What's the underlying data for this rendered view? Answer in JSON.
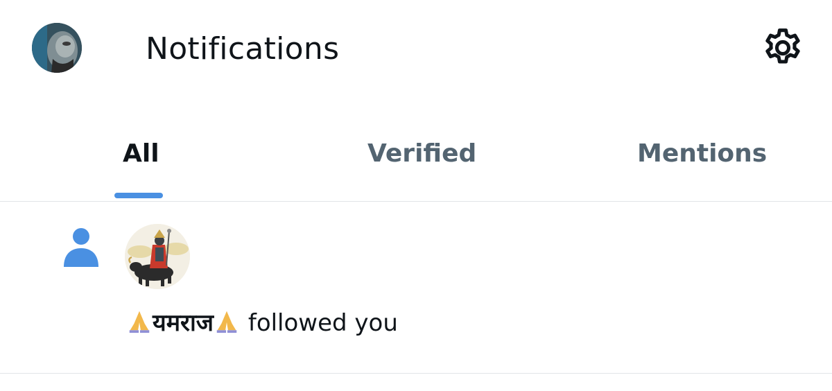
{
  "header": {
    "title": "Notifications",
    "avatar_icon": "user-avatar",
    "settings_icon": "gear-icon"
  },
  "tabs": [
    {
      "label": "All",
      "selected": true
    },
    {
      "label": "Verified",
      "selected": false
    },
    {
      "label": "Mentions",
      "selected": false
    }
  ],
  "colors": {
    "accent": "#4a90e2",
    "text_primary": "#0f1419",
    "text_secondary": "#536471",
    "divider": "#e1e4e7"
  },
  "notifications": [
    {
      "type_icon": "person-follow-icon",
      "user_name": "यमराज",
      "name_emoji": "folded-hands-emoji",
      "action": "followed you"
    }
  ]
}
